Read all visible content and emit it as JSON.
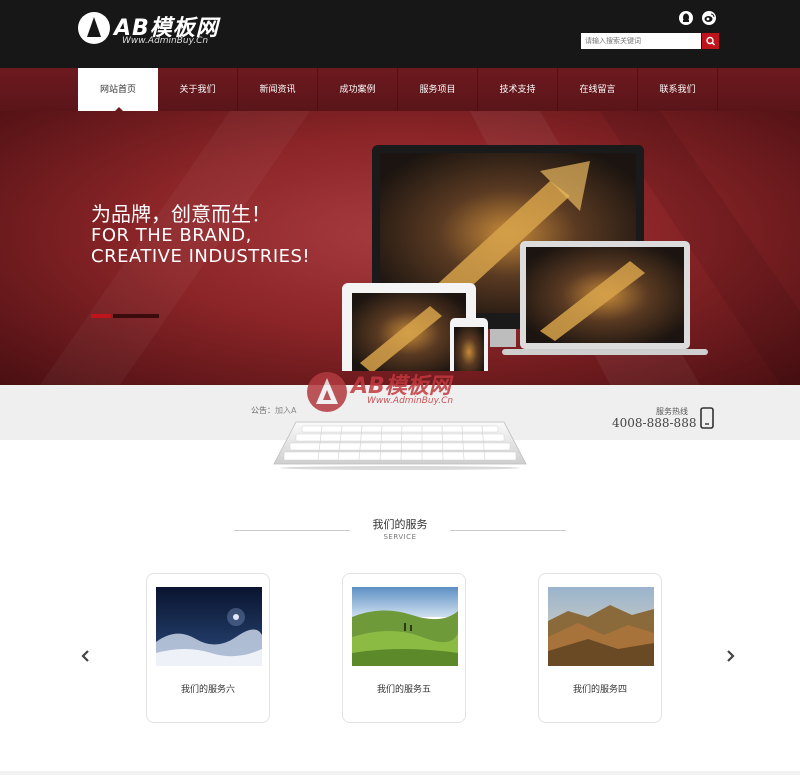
{
  "header": {
    "logo_title": "AB模板网",
    "logo_subtitle": "Www.AdminBuy.Cn",
    "social_icons": [
      "qq-icon",
      "weibo-icon"
    ],
    "search_placeholder": "请输入搜索关键词"
  },
  "nav": {
    "items": [
      {
        "label": "网站首页",
        "active": true
      },
      {
        "label": "关于我们",
        "active": false
      },
      {
        "label": "新闻资讯",
        "active": false
      },
      {
        "label": "成功案例",
        "active": false
      },
      {
        "label": "服务项目",
        "active": false
      },
      {
        "label": "技术支持",
        "active": false
      },
      {
        "label": "在线留言",
        "active": false
      },
      {
        "label": "联系我们",
        "active": false
      }
    ]
  },
  "banner": {
    "headline_cn": "为品牌，创意而生！",
    "headline_en_1": "FOR THE BRAND,",
    "headline_en_2": "CREATIVE INDUSTRIES!",
    "slide_count": 2,
    "active_slide": 1
  },
  "notice": {
    "label": "公告：",
    "text": "加入A",
    "hotline_label": "服务热线",
    "hotline_number": "4008-888-888"
  },
  "watermark": {
    "title": "AB模板网",
    "subtitle": "Www.AdminBuy.Cn"
  },
  "services": {
    "title": "我们的服务",
    "subtitle": "SERVICE",
    "cards": [
      {
        "label": "我们的服务六",
        "image": "night-sky"
      },
      {
        "label": "我们的服务五",
        "image": "green-hills"
      },
      {
        "label": "我们的服务四",
        "image": "mountain-ridge"
      }
    ],
    "prev_icon": "chevron-left-icon",
    "next_icon": "chevron-right-icon"
  },
  "colors": {
    "header_bg": "#171717",
    "nav_bg": "#6d1a1f",
    "accent": "#c0141c",
    "banner_bg": "#8c2528"
  }
}
